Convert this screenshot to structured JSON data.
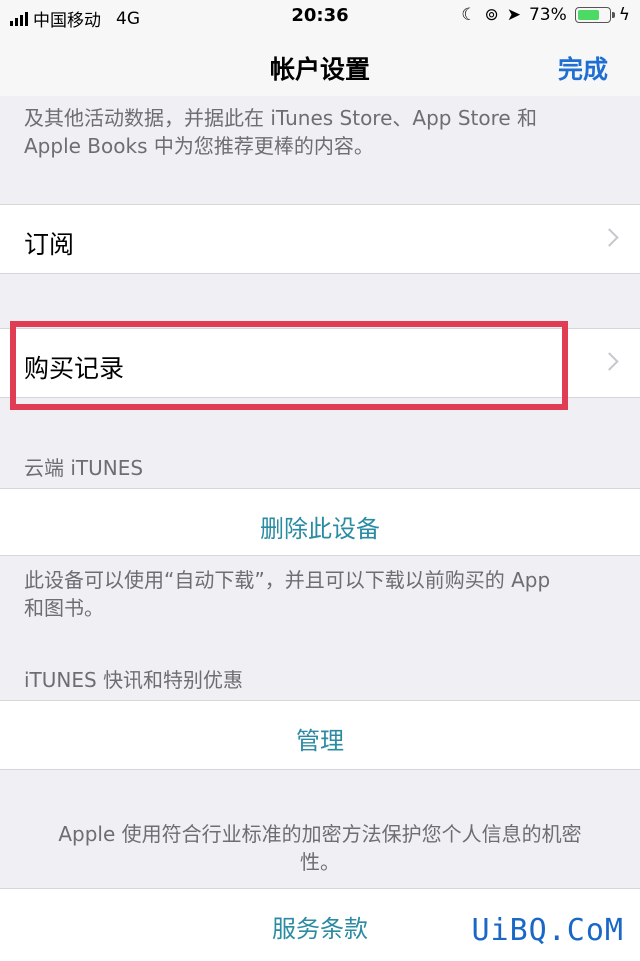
{
  "status_bar": {
    "carrier": "中国移动",
    "network": "4G",
    "time": "20:36",
    "battery": "73%",
    "battery_level": 0.73
  },
  "nav": {
    "title": "帐户设置",
    "done": "完成"
  },
  "top_text": {
    "line1": "及其他活动数据，并据此在 iTunes Store、App Store 和",
    "line2": "Apple Books 中为您推荐更棒的内容。"
  },
  "rows": {
    "subscriptions": "订阅",
    "purchase_history": "购买记录"
  },
  "itunes_cloud": {
    "header": "云端 iTUNES",
    "remove_device": "删除此设备",
    "note_line1": "此设备可以使用“自动下载”，并且可以下载以前购买的 App",
    "note_line2": "和图书。"
  },
  "itunes_news": {
    "header": "iTUNES 快讯和特别优惠",
    "manage": "管理"
  },
  "privacy": {
    "line1": "Apple 使用符合行业标准的加密方法保护您个人信息的机密",
    "line2": "性。"
  },
  "terms": "服务条款",
  "watermark": "UiBQ.CoM",
  "colors": {
    "link": "#2b8ba3",
    "nav_done": "#1f6fd2",
    "highlight": "#e03c54"
  }
}
